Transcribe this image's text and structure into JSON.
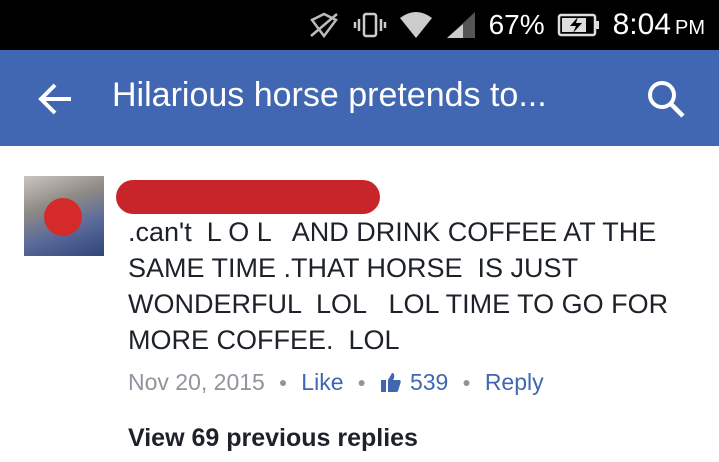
{
  "status_bar": {
    "battery_percent": "67%",
    "time": "8:04",
    "ampm": "PM",
    "icons": [
      "no-sim-icon",
      "vibrate-icon",
      "wifi-icon",
      "signal-icon",
      "battery-charging-icon"
    ]
  },
  "app_bar": {
    "title": "Hilarious horse pretends to...",
    "back_icon": "back-arrow-icon",
    "search_icon": "search-icon",
    "background": "#4267b2"
  },
  "comment": {
    "author": "",
    "text": ".can't  L O L   AND DRINK COFFEE AT THE SAME TIME .THAT HORSE  IS JUST WONDERFUL  LOL   LOL TIME TO GO FOR MORE COFFEE.  LOL",
    "date": "Nov 20, 2015",
    "like_label": "Like",
    "like_count": "539",
    "reply_label": "Reply",
    "redaction_color": "#c7252a"
  },
  "replies": {
    "view_previous_label": "View 69 previous replies"
  }
}
